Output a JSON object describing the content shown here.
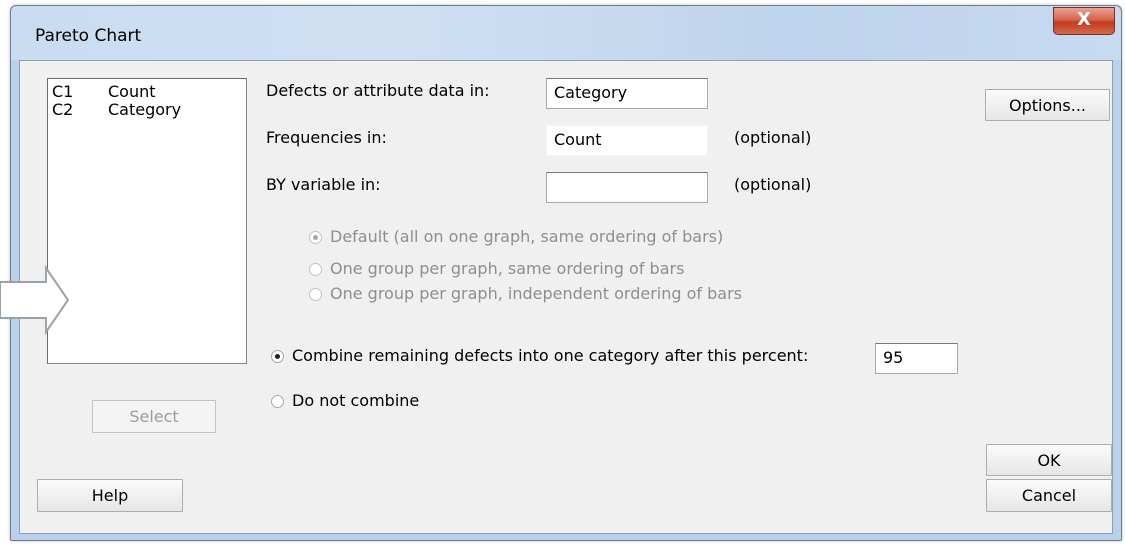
{
  "window": {
    "title": "Pareto Chart",
    "close_glyph": "X"
  },
  "variables": {
    "items": [
      {
        "id": "C1",
        "name": "Count"
      },
      {
        "id": "C2",
        "name": "Category"
      }
    ]
  },
  "fields": {
    "defects_label": "Defects or attribute data in:",
    "defects_value": "Category",
    "frequencies_label": "Frequencies in:",
    "frequencies_value": "Count",
    "frequencies_hint": "(optional)",
    "by_label": "BY variable in:",
    "by_value": "",
    "by_hint": "(optional)"
  },
  "grouping": {
    "default": "Default (all on one graph, same ordering of bars)",
    "same_order": "One group per graph, same ordering of bars",
    "independent": "One group per graph, independent ordering of bars"
  },
  "combine": {
    "combine_label": "Combine remaining defects into one category after this percent:",
    "percent_value": "95",
    "no_combine_label": "Do not combine"
  },
  "buttons": {
    "options": "Options...",
    "select": "Select",
    "help": "Help",
    "ok": "OK",
    "cancel": "Cancel"
  },
  "icons": {
    "pointer": "arrow-right-icon"
  }
}
